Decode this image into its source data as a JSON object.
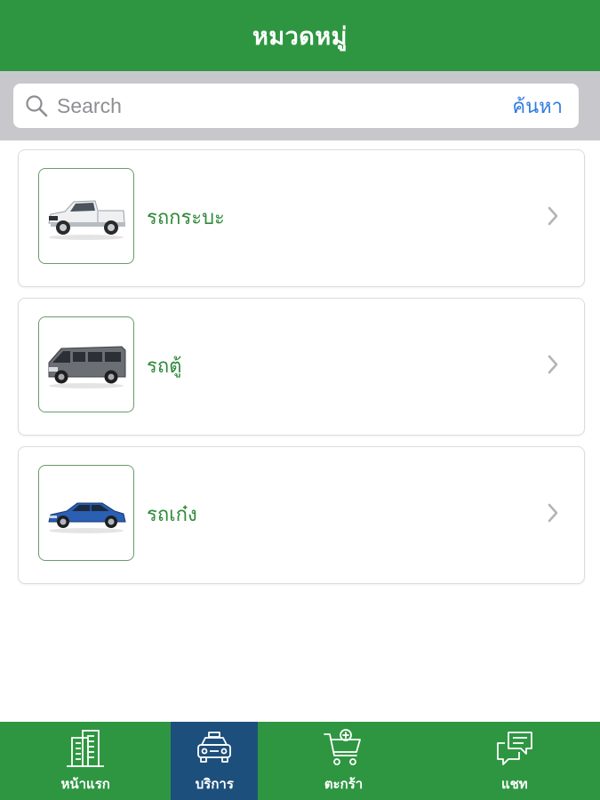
{
  "header": {
    "title": "หมวดหมู่"
  },
  "search": {
    "placeholder": "Search",
    "button_label": "ค้นหา"
  },
  "categories": [
    {
      "label": "รถกระบะ",
      "icon": "pickup-truck-icon"
    },
    {
      "label": "รถตู้",
      "icon": "van-icon"
    },
    {
      "label": "รถเก๋ง",
      "icon": "sedan-icon"
    }
  ],
  "tabbar": {
    "active_tab": 1,
    "tabs": [
      {
        "label": "หน้าแรก",
        "icon": "building-icon"
      },
      {
        "label": "บริการ",
        "icon": "taxi-icon"
      },
      {
        "label": "ตะกร้า",
        "icon": "cart-icon"
      },
      {
        "label": "แชท",
        "icon": "chat-icon"
      }
    ]
  },
  "colors": {
    "primary_green": "#2e9641",
    "active_tab_blue": "#1d4f7c",
    "link_blue": "#2f7be0",
    "label_green": "#2e8a38",
    "search_bar_gray": "#c8c8cc"
  }
}
